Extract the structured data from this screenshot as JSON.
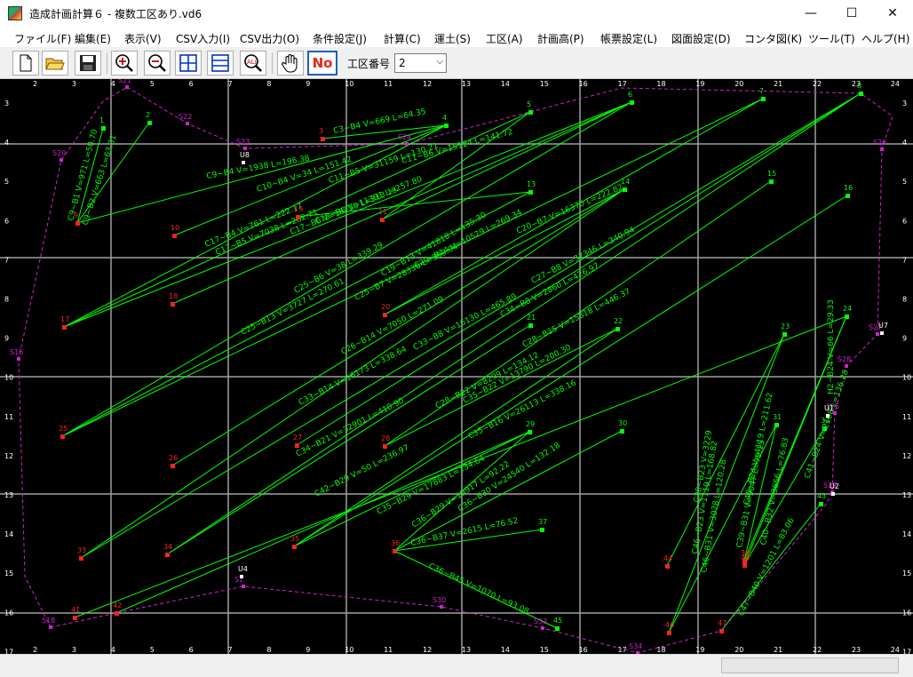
{
  "window": {
    "title": "造成計画計算６ - 複数工区あり.vd6",
    "minimize": "—",
    "maximize": "☐",
    "close": "✕"
  },
  "menu": [
    "ファイル(F)",
    "編集(E)",
    "表示(V)",
    "CSV入力(I)",
    "CSV出力(O)",
    "条件設定(J)",
    "計算(C)",
    "運土(S)",
    "工区(A)",
    "計画高(P)",
    "帳票設定(L)",
    "図面設定(D)",
    "コンタ図(K)",
    "ツール(T)",
    "ヘルプ(H)"
  ],
  "toolbar": {
    "buttons": [
      "new-file-icon",
      "open-folder-icon",
      "save-icon",
      "zoom-in-icon",
      "zoom-out-icon",
      "fit-horizontal-icon",
      "fit-vertical-icon",
      "zoom-all-icon",
      "pan-hand-icon"
    ],
    "no_button": "No",
    "koku_label": "工区番号",
    "koku_value": "2"
  },
  "colors": {
    "bg": "#000000",
    "grid": "#a0a0a0",
    "flow": "#00ff00",
    "red_node": "#ff2020",
    "boundary": "#d020d0",
    "label": "#ffffff"
  },
  "drawing": {
    "top_ticks": [
      "2",
      "3",
      "4",
      "5",
      "6",
      "7",
      "8",
      "9",
      "10",
      "11",
      "12",
      "13",
      "14",
      "15",
      "16",
      "17",
      "18",
      "19",
      "20",
      "21",
      "22",
      "23",
      "24"
    ],
    "bottom_ticks": [
      "2",
      "3",
      "4",
      "5",
      "6",
      "7",
      "8",
      "9",
      "10",
      "11",
      "12",
      "13",
      "14",
      "15",
      "16",
      "17",
      "18",
      "19",
      "20",
      "21",
      "22",
      "23",
      "24"
    ],
    "left_ticks": [
      "3",
      "4",
      "5",
      "6",
      "7",
      "8",
      "9",
      "10",
      "11",
      "12",
      "13",
      "14",
      "15",
      "16",
      "17"
    ],
    "right_ticks": [
      "3",
      "4",
      "5",
      "6",
      "7",
      "8",
      "9",
      "10",
      "11",
      "12",
      "13",
      "14",
      "15",
      "16",
      "17"
    ],
    "green_nodes": [
      "1",
      "2",
      "4",
      "5",
      "6",
      "7",
      "8",
      "13",
      "14",
      "15",
      "16",
      "21",
      "22",
      "23",
      "24",
      "29",
      "30",
      "31",
      "32",
      "37",
      "43",
      "45"
    ],
    "red_nodes": [
      "3",
      "9",
      "10",
      "11",
      "17",
      "18",
      "19",
      "20",
      "25",
      "26",
      "27",
      "28",
      "33",
      "34",
      "35",
      "36",
      "39",
      "40",
      "41",
      "42",
      "44",
      "46",
      "47"
    ],
    "boundary_nodes": [
      "S20",
      "S21",
      "S22",
      "S23",
      "S24",
      "S25",
      "S26",
      "S27",
      "S28",
      "S29",
      "S30",
      "S33",
      "S34",
      "S18",
      "S16",
      "S1"
    ],
    "white_nodes": [
      "U8",
      "U4",
      "U1",
      "U2",
      "U7"
    ],
    "flow_labels": [
      "C9~B1 V=971 L=50.70",
      "C9~B2 V=663 L=63.31",
      "C3~B4 V=669 L=64.35",
      "C9~B4 V=1938 L=196.38",
      "C10~B4 V=34 L=151.42",
      "C11~B5 V=31159 L=130.21",
      "C11~B6 V=15124 L=141.72",
      "C17~B4 V=761 L=222.17",
      "C17~B5 V=7038 L=262.71",
      "C18~B6 V=11391 L=257.80",
      "C17~B6 V=16250 L=313.13",
      "C25~B6 V=38 L=339.29",
      "C20~B7 V=16370 L=222.82",
      "C19~B13 V=41818 L=135.30",
      "C25~B13 V=3727 L=270.61",
      "C25~B7 V=28336 L=399.04",
      "C20~B14 V=10529 L=269.34",
      "C26~B14 V=7050 L=271.09",
      "C27~B8 V=37346 L=340.94",
      "C33~B8 V=16130 L=465.89",
      "C33~B14 V=16173 L=338.64",
      "C34~B8 V=2860 L=426.97",
      "C28~B15 V=15818 L=446.37",
      "C34~B21 V=32901 L=410.90",
      "C28~B22 V=8299 L=134.12",
      "C35~B22 V=13790 L=200.30",
      "C35~B16 V=26113 L=338.16",
      "C42~B29 V=50 L=236.97",
      "C35~B29 V=17883 L=134.64",
      "C36~B29 V=19917 L=92.22",
      "C36~B30 V=24540 L=132.18",
      "C36~B37 V=2615 L=76.52",
      "C36~B45 V=1070 L=93.08",
      "H2~B24 V=66 L=29.33",
      "C38~B23 V=3229",
      "C46~B23 V=1119 L=168.82",
      "C46~B31 V=3078 L=120.28",
      "C39~B31 V=9047 L=79.15",
      "C40~B32 V=3656 L=76.83",
      "C47~B40 V=1201 L=83.06",
      "C40~B24 V=4119 L=211.62",
      "C41~B24 V=2108 L=136.28"
    ]
  }
}
